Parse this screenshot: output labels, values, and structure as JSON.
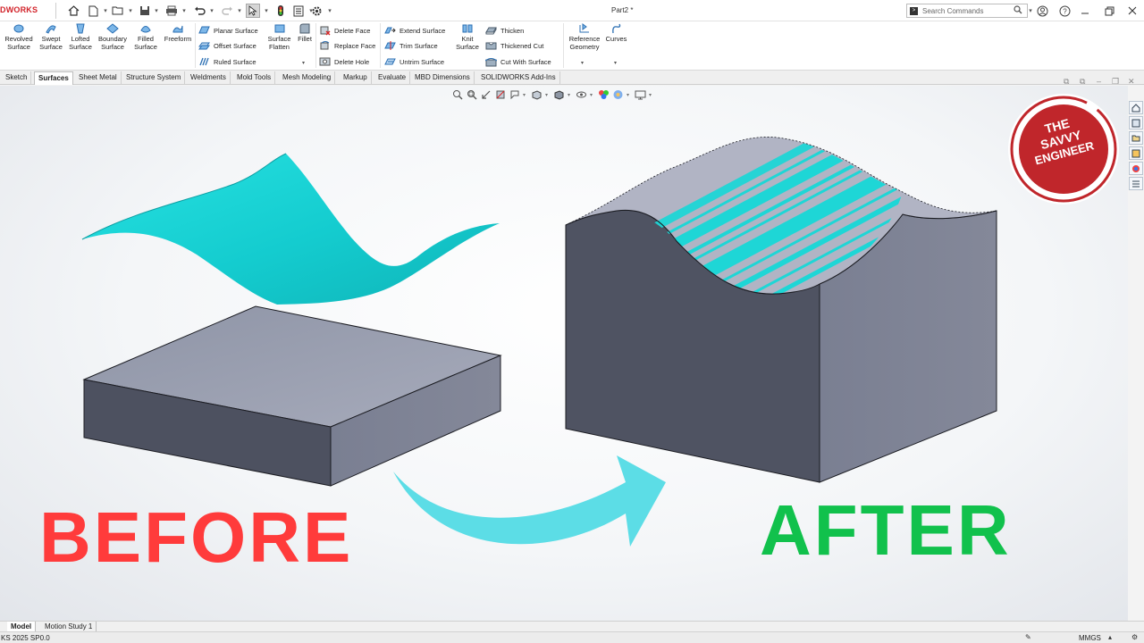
{
  "app": {
    "brand": "DWORKS",
    "document_title": "Part2 *"
  },
  "search": {
    "placeholder": "Search Commands"
  },
  "ribbon": {
    "revolved_surface": "Revolved Surface",
    "swept_surface": "Swept Surface",
    "lofted_surface": "Lofted Surface",
    "boundary_surface": "Boundary Surface",
    "filled_surface": "Filled Surface",
    "freeform": "Freeform",
    "planar_surface": "Planar Surface",
    "offset_surface": "Offset Surface",
    "ruled_surface": "Ruled Surface",
    "surface_flatten": "Surface Flatten",
    "fillet": "Fillet",
    "delete_face": "Delete Face",
    "replace_face": "Replace Face",
    "delete_hole": "Delete Hole",
    "extend_surface": "Extend Surface",
    "trim_surface": "Trim Surface",
    "untrim_surface": "Untrim Surface",
    "knit_surface": "Knit Surface",
    "thicken": "Thicken",
    "thickened_cut": "Thickened Cut",
    "cut_with_surface": "Cut With Surface",
    "reference_geometry": "Reference Geometry",
    "curves": "Curves"
  },
  "tabs": [
    "Sketch",
    "Surfaces",
    "Sheet Metal",
    "Structure System",
    "Weldments",
    "Mold Tools",
    "Mesh Modeling",
    "Markup",
    "Evaluate",
    "MBD Dimensions",
    "SOLIDWORKS Add-Ins"
  ],
  "active_tab": "Surfaces",
  "overlay": {
    "before": "BEFORE",
    "after": "AFTER",
    "logo_line1": "THE",
    "logo_line2": "SAVVY",
    "logo_line3": "ENGINEER"
  },
  "colors": {
    "surface_cyan": "#1ed6d6",
    "solid_gray": "#4f5362",
    "before_red": "#ff3b3b",
    "after_green": "#11c14c",
    "arrow_cyan": "#5cdde6",
    "logo_red": "#c0262b"
  },
  "bottom_tabs": [
    "Model",
    "Motion Study 1"
  ],
  "status": {
    "version": "KS 2025 SP0.0",
    "units": "MMGS"
  }
}
